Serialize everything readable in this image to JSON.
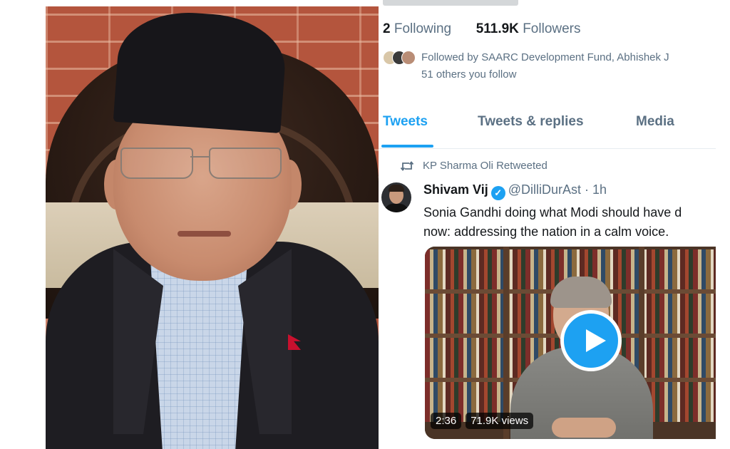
{
  "profile": {
    "following_count": "2",
    "following_label": "Following",
    "followers_count": "511.9K",
    "followers_label": "Followers",
    "followed_by_line1": "Followed by SAARC Development Fund, Abhishek J",
    "followed_by_line2": "51 others you follow"
  },
  "tabs": [
    {
      "label": "Tweets",
      "active": true
    },
    {
      "label": "Tweets & replies",
      "active": false
    },
    {
      "label": "Media",
      "active": false
    }
  ],
  "tweet": {
    "retweet_icon": "retweet-icon",
    "retweet_label": "KP Sharma Oli Retweeted",
    "author_name": "Shivam Vij",
    "verified_icon": "verified-badge-icon",
    "handle": "@DilliDurAst",
    "dot": "·",
    "time": "1h",
    "text_line1": "Sonia Gandhi doing what Modi should have d",
    "text_line2": "now: addressing the nation in a calm voice.",
    "video": {
      "duration": "2:36",
      "views": "71.9K views",
      "play_icon": "play-icon"
    }
  },
  "colors": {
    "twitter_blue": "#1da1f2",
    "secondary_text": "#5b7083",
    "primary_text": "#14171a"
  }
}
